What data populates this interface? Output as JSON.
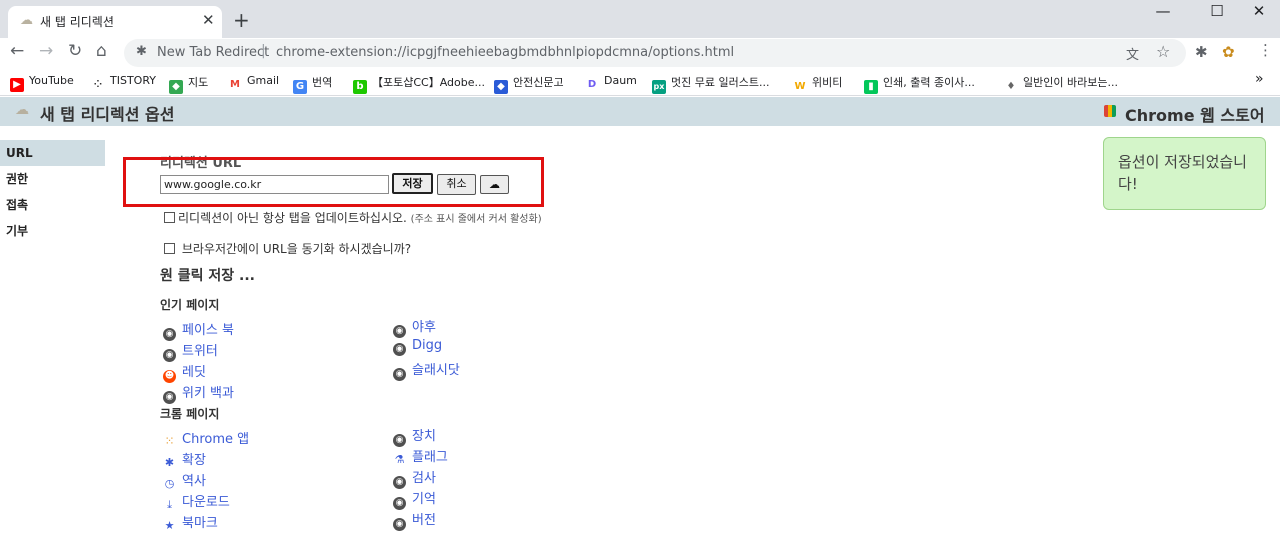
{
  "browser": {
    "tab_title": "새 탭 리디렉션",
    "address_site": "New Tab Redirect",
    "address_sep": "|",
    "address_url": "chrome-extension://icpgjfneehieebagbmdbhnlpiopdcmna/options.html",
    "window_min": "—",
    "window_max": "☐",
    "window_close": "✕"
  },
  "bookmarks": [
    {
      "label": "YouTube",
      "color": "#ff0000",
      "glyph": "▶"
    },
    {
      "label": "TISTORY",
      "color": "#333333",
      "glyph": "⁘"
    },
    {
      "label": "지도",
      "color": "#34a853",
      "glyph": "◆"
    },
    {
      "label": "Gmail",
      "color": "#ea4335",
      "glyph": "M"
    },
    {
      "label": "번역",
      "color": "#4285f4",
      "glyph": "G"
    },
    {
      "label": "【포토샵CC】Adobe...",
      "color": "#1ec800",
      "glyph": "b"
    },
    {
      "label": "안전신문고",
      "color": "#2a5bd7",
      "glyph": "◆"
    },
    {
      "label": "Daum",
      "color": "#6e5cf2",
      "glyph": "D"
    },
    {
      "label": "멋진 무료 일러스트...",
      "color": "#05a081",
      "glyph": "px"
    },
    {
      "label": "위비티",
      "color": "#f2a900",
      "glyph": "W"
    },
    {
      "label": "인쇄, 출력 종이사...",
      "color": "#03c75a",
      "glyph": "▮"
    },
    {
      "label": "일반인이 바라보는...",
      "color": "#666666",
      "glyph": "♦"
    }
  ],
  "header": {
    "title": "새 탭 리디렉션 옵션",
    "store_link": "Chrome 웹 스토어"
  },
  "nav": [
    {
      "label": "URL",
      "active": true
    },
    {
      "label": "권한",
      "active": false
    },
    {
      "label": "접촉",
      "active": false
    },
    {
      "label": "기부",
      "active": false
    }
  ],
  "form": {
    "url_label": "리디렉션 URL",
    "url_value": "www.google.co.kr",
    "save_label": "저장",
    "cancel_label": "취소",
    "update_tab_label": "리디렉션이 아닌 항상 탭을 업데이트하십시오.",
    "update_tab_note": "(주소 표시 줄에서 커서 활성화)",
    "sync_label": "브라우저간에이 URL을 동기화 하시겠습니까?"
  },
  "oneclick": {
    "heading": "원 클릭 저장 ...",
    "popular_heading": "인기 페이지",
    "chrome_heading": "크롬 페이지",
    "popular_left": [
      {
        "label": "페이스 북",
        "icon": "globe-icon"
      },
      {
        "label": "트위터",
        "icon": "globe-icon"
      },
      {
        "label": "레딧",
        "icon": "reddit-icon"
      },
      {
        "label": "위키 백과",
        "icon": "globe-icon"
      }
    ],
    "popular_right": [
      {
        "label": "야후",
        "icon": "globe-icon"
      },
      {
        "label": "Digg",
        "icon": "globe-icon"
      },
      {
        "label": "슬래시닷",
        "icon": "globe-icon"
      }
    ],
    "chrome_left": [
      {
        "label": "Chrome 앱",
        "icon": "apps-grid-icon"
      },
      {
        "label": "확장",
        "icon": "puzzle-icon"
      },
      {
        "label": "역사",
        "icon": "history-icon"
      },
      {
        "label": "다운로드",
        "icon": "download-icon"
      },
      {
        "label": "북마크",
        "icon": "star-icon"
      }
    ],
    "chrome_right": [
      {
        "label": "장치",
        "icon": "globe-icon"
      },
      {
        "label": "플래그",
        "icon": "flask-icon"
      },
      {
        "label": "검사",
        "icon": "globe-icon"
      },
      {
        "label": "기억",
        "icon": "globe-icon"
      },
      {
        "label": "버전",
        "icon": "globe-icon"
      }
    ]
  },
  "toast": {
    "message": "옵션이 저장되었습니다!"
  },
  "colors": {
    "header_bg": "#cfdde3",
    "link": "#3b5bd6",
    "toast_bg": "#d4f5c9",
    "highlight": "#e01010"
  }
}
